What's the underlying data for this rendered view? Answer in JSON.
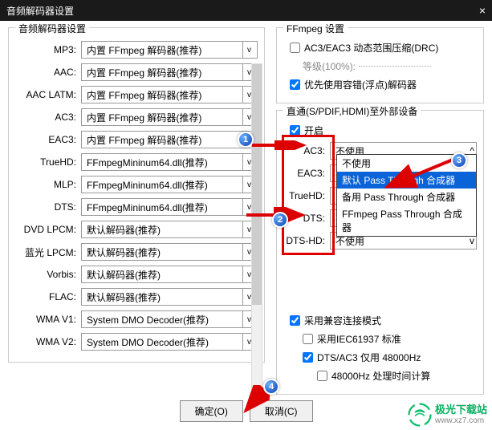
{
  "window": {
    "title": "音频解码器设置",
    "close": "×"
  },
  "left": {
    "group_title": "音频解码器设置",
    "rows": [
      {
        "label": "MP3:",
        "value": "内置 FFmpeg 解码器(推荐)"
      },
      {
        "label": "AAC:",
        "value": "内置 FFmpeg 解码器(推荐)"
      },
      {
        "label": "AAC LATM:",
        "value": "内置 FFmpeg 解码器(推荐)"
      },
      {
        "label": "AC3:",
        "value": "内置 FFmpeg 解码器(推荐)"
      },
      {
        "label": "EAC3:",
        "value": "内置 FFmpeg 解码器(推荐)"
      },
      {
        "label": "TrueHD:",
        "value": "FFmpegMininum64.dll(推荐)"
      },
      {
        "label": "MLP:",
        "value": "FFmpegMininum64.dll(推荐)"
      },
      {
        "label": "DTS:",
        "value": "FFmpegMininum64.dll(推荐)"
      },
      {
        "label": "DVD LPCM:",
        "value": "默认解码器(推荐)"
      },
      {
        "label": "蓝光 LPCM:",
        "value": "默认解码器(推荐)"
      },
      {
        "label": "Vorbis:",
        "value": "默认解码器(推荐)"
      },
      {
        "label": "FLAC:",
        "value": "默认解码器(推荐)"
      },
      {
        "label": "WMA V1:",
        "value": "System DMO Decoder(推荐)"
      },
      {
        "label": "WMA V2:",
        "value": "System DMO Decoder(推荐)"
      }
    ]
  },
  "right": {
    "group_title": "FFmpeg 设置",
    "drc": "AC3/EAC3 动态范围压缩(DRC)",
    "level": "等级(100%):",
    "prefer_float": "优先使用容错(浮点)解码器",
    "passthrough_title": "直通(S/PDIF,HDMI)至外部设备",
    "enable": "开启",
    "pt_rows": [
      {
        "label": "AC3:",
        "value": "不使用"
      },
      {
        "label": "EAC3:",
        "value": "不使用"
      },
      {
        "label": "TrueHD:",
        "value": ""
      },
      {
        "label": "DTS:",
        "value": "不使用"
      },
      {
        "label": "DTS-HD:",
        "value": "不使用"
      }
    ],
    "dropdown": [
      "不使用",
      "默认 Pass Through 合成器",
      "备用 Pass Through 合成器",
      "FFmpeg Pass Through 合成器"
    ],
    "compat": "采用兼容连接模式",
    "iec": "采用IEC61937 标准",
    "dts_ac3": "DTS/AC3 仅用 48000Hz",
    "timing": "48000Hz 处理时间计算"
  },
  "buttons": {
    "ok": "确定(O)",
    "cancel": "取消(C)"
  },
  "badges": {
    "b1": "1",
    "b2": "2",
    "b3": "3",
    "b4": "4"
  },
  "logo": {
    "cn": "极光下载站",
    "url": "www.xz7.com"
  }
}
